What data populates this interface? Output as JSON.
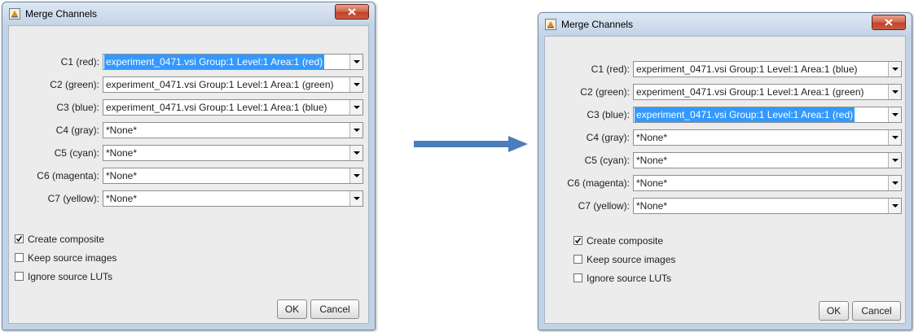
{
  "colors": {
    "frame": "#c3d3e6",
    "content_bg": "#ececec",
    "selection": "#3399ff",
    "close_button": "#c0432a",
    "arrow": "#4a7ebb"
  },
  "icons": {
    "app": "java-window-icon",
    "close": "close-x-icon",
    "dropdown": "triangle-down-icon",
    "transition": "right-arrow-icon"
  },
  "before": {
    "title": "Merge Channels",
    "channels": [
      {
        "label": "C1 (red):",
        "value": "experiment_0471.vsi Group:1 Level:1 Area:1 (red)",
        "highlighted": true
      },
      {
        "label": "C2 (green):",
        "value": "experiment_0471.vsi Group:1 Level:1 Area:1 (green)",
        "highlighted": false
      },
      {
        "label": "C3 (blue):",
        "value": "experiment_0471.vsi Group:1 Level:1 Area:1 (blue)",
        "highlighted": false
      },
      {
        "label": "C4 (gray):",
        "value": "*None*",
        "highlighted": false
      },
      {
        "label": "C5 (cyan):",
        "value": "*None*",
        "highlighted": false
      },
      {
        "label": "C6 (magenta):",
        "value": "*None*",
        "highlighted": false
      },
      {
        "label": "C7 (yellow):",
        "value": "*None*",
        "highlighted": false
      }
    ],
    "options": [
      {
        "label": "Create composite",
        "checked": true
      },
      {
        "label": "Keep source images",
        "checked": false
      },
      {
        "label": "Ignore source LUTs",
        "checked": false
      }
    ],
    "ok_label": "OK",
    "cancel_label": "Cancel"
  },
  "after": {
    "title": "Merge Channels",
    "channels": [
      {
        "label": "C1 (red):",
        "value": "experiment_0471.vsi Group:1 Level:1 Area:1 (blue)",
        "highlighted": false
      },
      {
        "label": "C2 (green):",
        "value": "experiment_0471.vsi Group:1 Level:1 Area:1 (green)",
        "highlighted": false
      },
      {
        "label": "C3 (blue):",
        "value": "experiment_0471.vsi Group:1 Level:1 Area:1 (red)",
        "highlighted": true
      },
      {
        "label": "C4 (gray):",
        "value": "*None*",
        "highlighted": false
      },
      {
        "label": "C5 (cyan):",
        "value": "*None*",
        "highlighted": false
      },
      {
        "label": "C6 (magenta):",
        "value": "*None*",
        "highlighted": false
      },
      {
        "label": "C7 (yellow):",
        "value": "*None*",
        "highlighted": false
      }
    ],
    "options": [
      {
        "label": "Create composite",
        "checked": true
      },
      {
        "label": "Keep source images",
        "checked": false
      },
      {
        "label": "Ignore source LUTs",
        "checked": false
      }
    ],
    "ok_label": "OK",
    "cancel_label": "Cancel"
  }
}
